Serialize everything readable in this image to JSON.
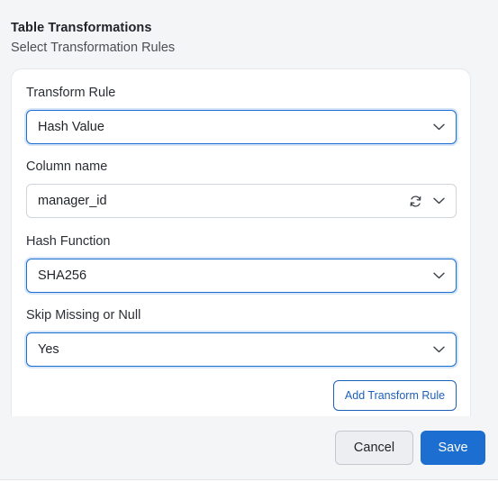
{
  "header": {
    "title": "Table Transformations",
    "subtitle": "Select Transformation Rules"
  },
  "form": {
    "transform_rule": {
      "label": "Transform Rule",
      "value": "Hash Value"
    },
    "column_name": {
      "label": "Column name",
      "value": "manager_id"
    },
    "hash_function": {
      "label": "Hash Function",
      "value": "SHA256"
    },
    "skip_missing": {
      "label": "Skip Missing or Null",
      "value": "Yes"
    },
    "add_rule_label": "Add Transform Rule"
  },
  "footer": {
    "cancel_label": "Cancel",
    "save_label": "Save"
  },
  "icons": {
    "dropdown": "chevron-down-icon",
    "refresh": "refresh-icon"
  },
  "colors": {
    "accent": "#1c6fd1",
    "background": "#f4f5f7",
    "card": "#ffffff"
  }
}
